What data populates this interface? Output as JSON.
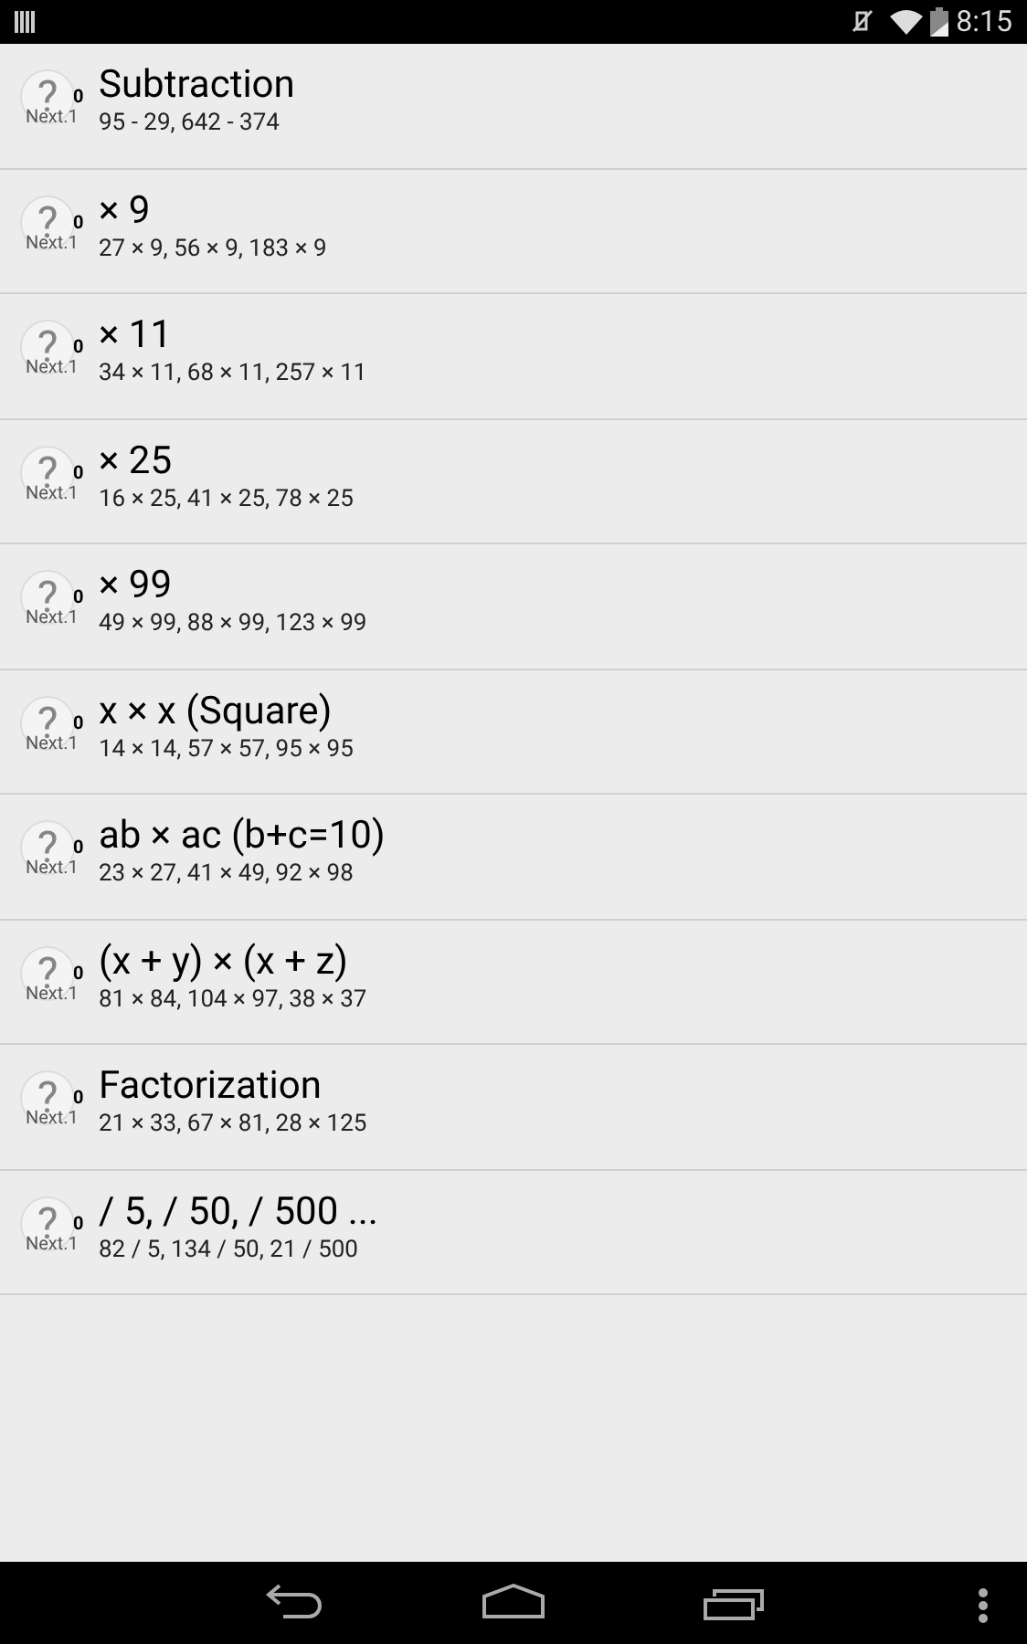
{
  "status_bar": {
    "time": "8:15"
  },
  "items": [
    {
      "badge": "?",
      "count": "0",
      "next": "Next.1",
      "title": "Subtraction",
      "examples": "95 - 29, 642 - 374"
    },
    {
      "badge": "?",
      "count": "0",
      "next": "Next.1",
      "title": "× 9",
      "examples": "27 × 9, 56 × 9, 183 × 9"
    },
    {
      "badge": "?",
      "count": "0",
      "next": "Next.1",
      "title": "× 11",
      "examples": "34 × 11, 68 × 11, 257 × 11"
    },
    {
      "badge": "?",
      "count": "0",
      "next": "Next.1",
      "title": "× 25",
      "examples": "16 × 25, 41 × 25, 78 × 25"
    },
    {
      "badge": "?",
      "count": "0",
      "next": "Next.1",
      "title": "× 99",
      "examples": "49 × 99, 88 × 99, 123 × 99"
    },
    {
      "badge": "?",
      "count": "0",
      "next": "Next.1",
      "title": "x × x (Square)",
      "examples": "14 × 14, 57 × 57, 95 × 95"
    },
    {
      "badge": "?",
      "count": "0",
      "next": "Next.1",
      "title": "ab × ac (b+c=10)",
      "examples": "23 × 27, 41 × 49, 92 × 98"
    },
    {
      "badge": "?",
      "count": "0",
      "next": "Next.1",
      "title": "(x + y) × (x + z)",
      "examples": "81 × 84, 104 × 97, 38 × 37"
    },
    {
      "badge": "?",
      "count": "0",
      "next": "Next.1",
      "title": "Factorization",
      "examples": "21 × 33, 67 × 81, 28 × 125"
    },
    {
      "badge": "?",
      "count": "0",
      "next": "Next.1",
      "title": "/ 5, / 50, / 500 ...",
      "examples": "82 / 5, 134 / 50, 21 / 500"
    }
  ]
}
